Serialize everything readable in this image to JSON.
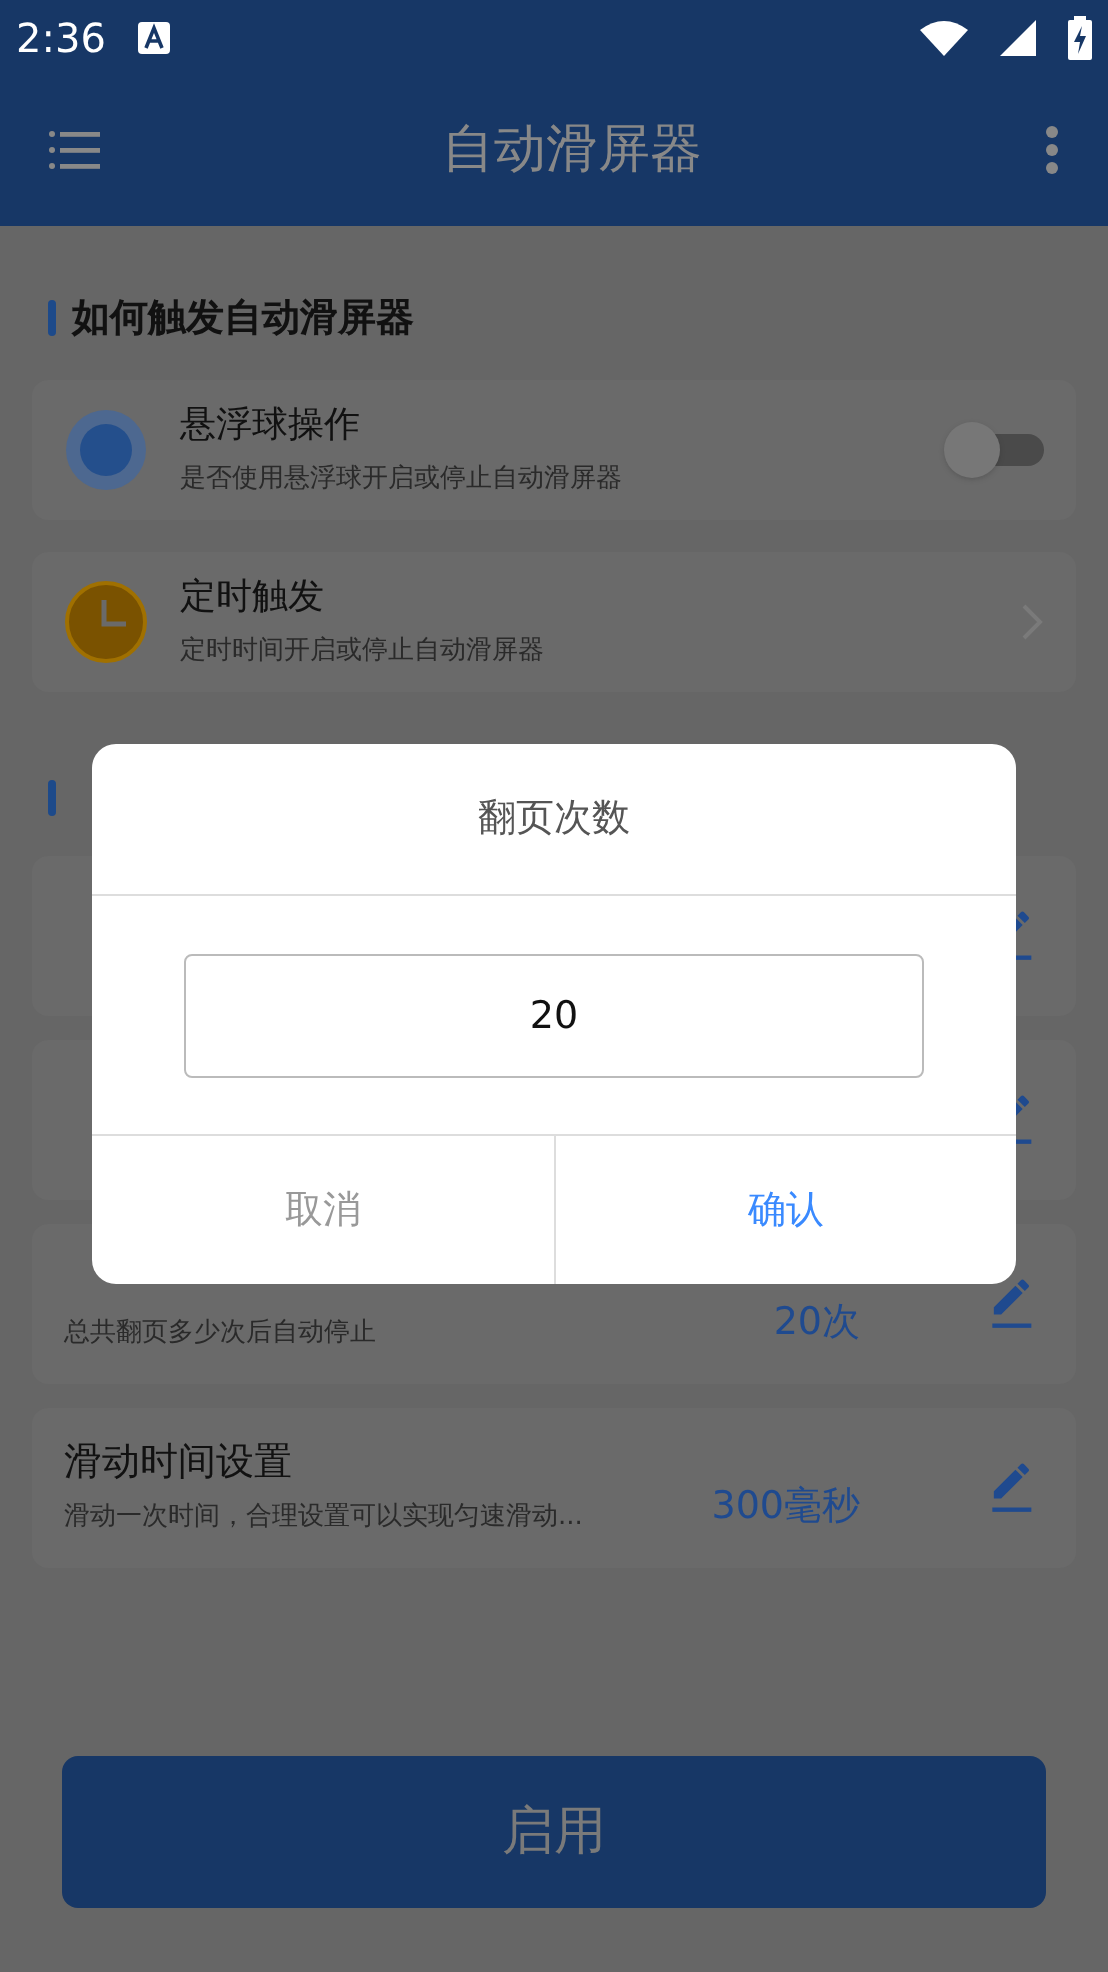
{
  "status_bar": {
    "time": "2:36"
  },
  "app_bar": {
    "title": "自动滑屏器"
  },
  "trigger_section": {
    "heading": "如何触发自动滑屏器",
    "items": [
      {
        "kind": "switch",
        "title": "悬浮球操作",
        "subtitle": "是否使用悬浮球开启或停止自动滑屏器",
        "on": false
      },
      {
        "kind": "link",
        "title": "定时触发",
        "subtitle": "定时时间开启或停止自动滑屏器"
      }
    ]
  },
  "settings_section": {
    "rows": [
      {
        "kind": "editable"
      },
      {
        "kind": "editable"
      },
      {
        "kind": "editable",
        "subtitle": "总共翻页多少次后自动停止",
        "value": "20次"
      },
      {
        "kind": "editable",
        "title": "滑动时间设置",
        "subtitle": "滑动一次时间，合理设置可以实现匀速滑动...",
        "value": "300毫秒"
      }
    ]
  },
  "enable_button": "启用",
  "dialog": {
    "title": "翻页次数",
    "value": "20",
    "cancel": "取消",
    "confirm": "确认"
  }
}
